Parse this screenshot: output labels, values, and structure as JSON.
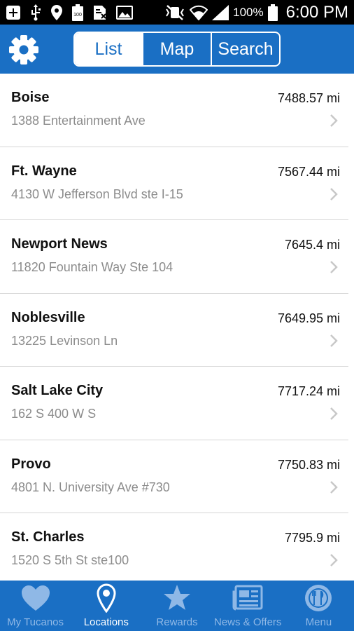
{
  "status_bar": {
    "battery_percent": "100%",
    "time": "6:00 PM",
    "icons": [
      "add-box-icon",
      "usb-icon",
      "location-pin-icon",
      "battery-100-icon",
      "no-sim-icon",
      "image-icon",
      "muted-vibrate-icon",
      "wifi-icon",
      "signal-icon",
      "battery-icon"
    ]
  },
  "header": {
    "settings_icon": "gear-icon",
    "segments": [
      {
        "label": "List",
        "active": true
      },
      {
        "label": "Map",
        "active": false
      },
      {
        "label": "Search",
        "active": false
      }
    ]
  },
  "locations": [
    {
      "name": "Boise",
      "distance": "7488.57 mi",
      "address": "1388 Entertainment Ave"
    },
    {
      "name": "Ft. Wayne",
      "distance": "7567.44 mi",
      "address": "4130 W Jefferson Blvd  ste I-15"
    },
    {
      "name": "Newport News",
      "distance": "7645.4 mi",
      "address": "11820 Fountain Way Ste 104"
    },
    {
      "name": "Noblesville",
      "distance": "7649.95 mi",
      "address": "13225 Levinson Ln"
    },
    {
      "name": "Salt Lake City",
      "distance": "7717.24 mi",
      "address": "162 S 400 W S"
    },
    {
      "name": "Provo",
      "distance": "7750.83 mi",
      "address": "4801 N. University Ave #730"
    },
    {
      "name": "St. Charles",
      "distance": "7795.9 mi",
      "address": "1520 S 5th St ste100"
    }
  ],
  "tabs": [
    {
      "label": "My Tucanos",
      "icon": "heart-icon",
      "active": false
    },
    {
      "label": "Locations",
      "icon": "location-pin-icon",
      "active": true
    },
    {
      "label": "Rewards",
      "icon": "star-icon",
      "active": false
    },
    {
      "label": "News & Offers",
      "icon": "newspaper-icon",
      "active": false
    },
    {
      "label": "Menu",
      "icon": "plate-cutlery-icon",
      "active": false
    }
  ],
  "colors": {
    "brand_blue": "#1a6fc4",
    "tab_inactive": "#8fb8e6",
    "address_gray": "#8c8c8c",
    "chevron_gray": "#c8c8c8"
  }
}
